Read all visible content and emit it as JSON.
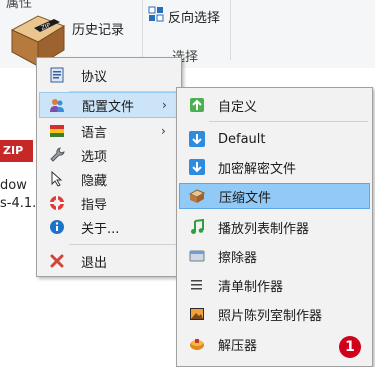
{
  "ribbon": {
    "top_partial": "属性",
    "history": "历史记录",
    "invert_selection": "反向选择",
    "select_group": "选择"
  },
  "background_files": {
    "badge_text": "ZIP",
    "line1": "dow",
    "line2": "s-4.1."
  },
  "main_menu": {
    "items": [
      {
        "label": "协议",
        "icon": "document-list-icon"
      },
      {
        "label": "配置文件",
        "icon": "users-icon",
        "has_submenu": true
      },
      {
        "label": "语言",
        "icon": "flag-icon",
        "has_submenu": true
      },
      {
        "label": "选项",
        "icon": "wrench-icon"
      },
      {
        "label": "隐藏",
        "icon": "cursor-icon"
      },
      {
        "label": "指导",
        "icon": "lifebuoy-icon"
      },
      {
        "label": "关于...",
        "icon": "info-icon"
      },
      {
        "label": "退出",
        "icon": "close-icon"
      }
    ]
  },
  "sub_menu": {
    "items": [
      {
        "label": "自定义",
        "icon": "custom-icon"
      },
      {
        "label": "Default",
        "icon": "download-icon"
      },
      {
        "label": "加密解密文件",
        "icon": "download-icon"
      },
      {
        "label": "压缩文件",
        "icon": "compress-icon"
      },
      {
        "label": "播放列表制作器",
        "icon": "music-icon"
      },
      {
        "label": "擦除器",
        "icon": "eraser-icon"
      },
      {
        "label": "清单制作器",
        "icon": "list-icon"
      },
      {
        "label": "照片陈列室制作器",
        "icon": "photo-icon"
      },
      {
        "label": "解压器",
        "icon": "box-icon"
      }
    ]
  },
  "annotation": {
    "number": "1"
  },
  "colors": {
    "menu_bg": "#f2f2f2",
    "hover_bg": "#cce4f7",
    "selected_bg": "#91c9f7",
    "badge_red": "#d0021b"
  }
}
